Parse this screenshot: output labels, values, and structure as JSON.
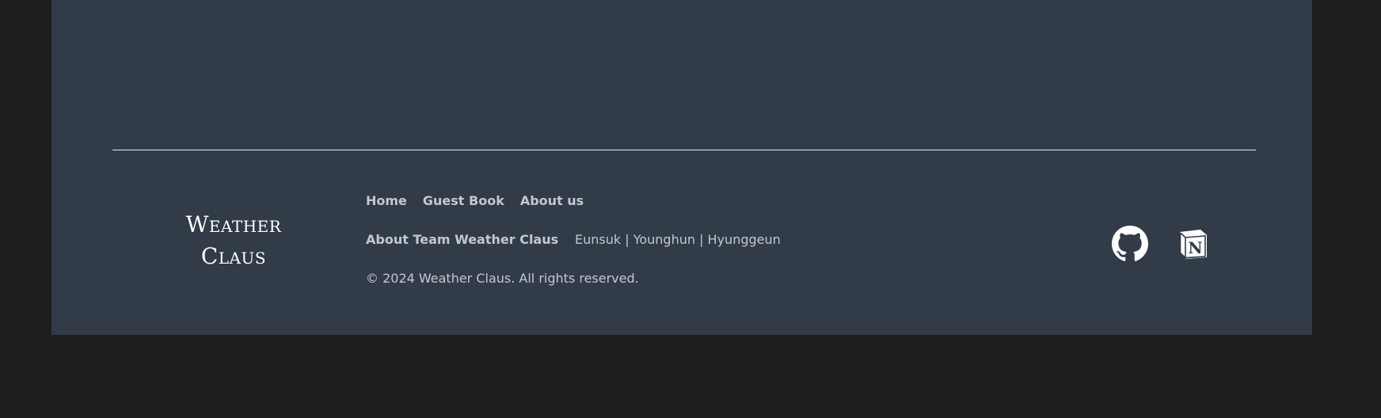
{
  "footer": {
    "logo_line1": "Weather",
    "logo_line2": "Claus",
    "nav": {
      "home": "Home",
      "guest_book": "Guest Book",
      "about_us": "About us"
    },
    "team_label": "About Team Weather Claus",
    "team_members": "Eunsuk | Younghun | Hyunggeun",
    "copyright": "© 2024 Weather Claus. All rights reserved."
  },
  "icons": {
    "github": "github-icon",
    "notion": "notion-icon"
  },
  "colors": {
    "background": "#1e1e1e",
    "panel": "#323b48",
    "text": "#c3c8cf",
    "logo": "#ffffff",
    "divider": "#e9ecef"
  }
}
